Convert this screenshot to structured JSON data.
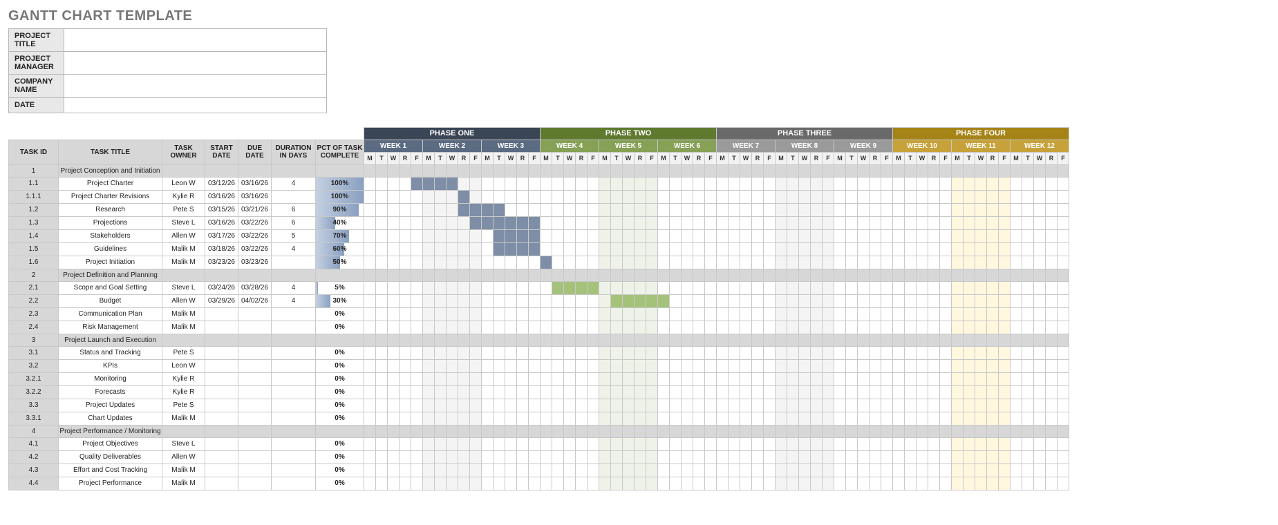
{
  "title": "GANTT CHART TEMPLATE",
  "info": {
    "labels": {
      "project_title": "PROJECT TITLE",
      "project_manager": "PROJECT MANAGER",
      "company_name": "COMPANY NAME",
      "date": "DATE"
    },
    "values": {
      "project_title": "",
      "project_manager": "",
      "company_name": "",
      "date": ""
    }
  },
  "left_headers": {
    "task_id": "TASK ID",
    "task_title": "TASK TITLE",
    "task_owner": "TASK OWNER",
    "start_date": "START DATE",
    "due_date": "DUE DATE",
    "duration": "DURATION IN DAYS",
    "pct": "PCT OF TASK COMPLETE"
  },
  "phases": [
    {
      "label": "PHASE ONE",
      "cls": "phase1",
      "weeks": [
        "WEEK 1",
        "WEEK 2",
        "WEEK 3"
      ]
    },
    {
      "label": "PHASE TWO",
      "cls": "phase2",
      "weeks": [
        "WEEK 4",
        "WEEK 5",
        "WEEK 6"
      ]
    },
    {
      "label": "PHASE THREE",
      "cls": "phase3",
      "weeks": [
        "WEEK 7",
        "WEEK 8",
        "WEEK 9"
      ]
    },
    {
      "label": "PHASE FOUR",
      "cls": "phase4",
      "weeks": [
        "WEEK 10",
        "WEEK 11",
        "WEEK 12"
      ]
    }
  ],
  "day_labels": [
    "M",
    "T",
    "W",
    "R",
    "F"
  ],
  "shaded_weeks": [
    1,
    4,
    7,
    10
  ],
  "tint_weeks": {
    "4": "tint1",
    "10": "tint2"
  },
  "tasks": [
    {
      "id": "1",
      "title": "Project Conception and Initiation",
      "section": true
    },
    {
      "id": "1.1",
      "title": "Project Charter",
      "owner": "Leon W",
      "start": "03/12/26",
      "due": "03/16/26",
      "dur": "4",
      "pct": 100,
      "bar": {
        "color": "blue",
        "start": 4,
        "end": 7
      },
      "indent": 1
    },
    {
      "id": "1.1.1",
      "title": "Project Charter Revisions",
      "owner": "Kylie R",
      "start": "03/16/26",
      "due": "03/16/26",
      "dur": "",
      "pct": 100,
      "bar": {
        "color": "blue",
        "start": 8,
        "end": 8
      },
      "indent": 2
    },
    {
      "id": "1.2",
      "title": "Research",
      "owner": "Pete S",
      "start": "03/15/26",
      "due": "03/21/26",
      "dur": "6",
      "pct": 90,
      "bar": {
        "color": "blue",
        "start": 8,
        "end": 11
      },
      "indent": 1
    },
    {
      "id": "1.3",
      "title": "Projections",
      "owner": "Steve L",
      "start": "03/16/26",
      "due": "03/22/26",
      "dur": "6",
      "pct": 40,
      "bar": {
        "color": "blue",
        "start": 9,
        "end": 14
      },
      "indent": 1
    },
    {
      "id": "1.4",
      "title": "Stakeholders",
      "owner": "Allen W",
      "start": "03/17/26",
      "due": "03/22/26",
      "dur": "5",
      "pct": 70,
      "bar": {
        "color": "blue",
        "start": 11,
        "end": 14
      },
      "indent": 1
    },
    {
      "id": "1.5",
      "title": "Guidelines",
      "owner": "Malik M",
      "start": "03/18/26",
      "due": "03/22/26",
      "dur": "4",
      "pct": 60,
      "bar": {
        "color": "blue",
        "start": 11,
        "end": 14
      },
      "indent": 1
    },
    {
      "id": "1.6",
      "title": "Project Initiation",
      "owner": "Malik M",
      "start": "03/23/26",
      "due": "03/23/26",
      "dur": "",
      "pct": 50,
      "bar": {
        "color": "blue",
        "start": 15,
        "end": 15
      },
      "indent": 1
    },
    {
      "id": "2",
      "title": "Project Definition and Planning",
      "section": true
    },
    {
      "id": "2.1",
      "title": "Scope and Goal Setting",
      "owner": "Steve L",
      "start": "03/24/26",
      "due": "03/28/26",
      "dur": "4",
      "pct": 5,
      "bar": {
        "color": "green",
        "start": 16,
        "end": 19
      },
      "indent": 1
    },
    {
      "id": "2.2",
      "title": "Budget",
      "owner": "Allen W",
      "start": "03/29/26",
      "due": "04/02/26",
      "dur": "4",
      "pct": 30,
      "bar": {
        "color": "green",
        "start": 21,
        "end": 25
      },
      "indent": 1
    },
    {
      "id": "2.3",
      "title": "Communication Plan",
      "owner": "Malik M",
      "start": "",
      "due": "",
      "dur": "",
      "pct": 0,
      "indent": 1
    },
    {
      "id": "2.4",
      "title": "Risk Management",
      "owner": "Malik M",
      "start": "",
      "due": "",
      "dur": "",
      "pct": 0,
      "indent": 1
    },
    {
      "id": "3",
      "title": "Project Launch and Execution",
      "section": true
    },
    {
      "id": "3.1",
      "title": "Status and Tracking",
      "owner": "Pete S",
      "start": "",
      "due": "",
      "dur": "",
      "pct": 0,
      "indent": 1
    },
    {
      "id": "3.2",
      "title": "KPIs",
      "owner": "Leon W",
      "start": "",
      "due": "",
      "dur": "",
      "pct": 0,
      "indent": 1
    },
    {
      "id": "3.2.1",
      "title": "Monitoring",
      "owner": "Kylie R",
      "start": "",
      "due": "",
      "dur": "",
      "pct": 0,
      "indent": 2
    },
    {
      "id": "3.2.2",
      "title": "Forecasts",
      "owner": "Kylie R",
      "start": "",
      "due": "",
      "dur": "",
      "pct": 0,
      "indent": 2
    },
    {
      "id": "3.3",
      "title": "Project Updates",
      "owner": "Pete S",
      "start": "",
      "due": "",
      "dur": "",
      "pct": 0,
      "indent": 1
    },
    {
      "id": "3.3.1",
      "title": "Chart Updates",
      "owner": "Malik M",
      "start": "",
      "due": "",
      "dur": "",
      "pct": 0,
      "indent": 2
    },
    {
      "id": "4",
      "title": "Project Performance / Monitoring",
      "section": true
    },
    {
      "id": "4.1",
      "title": "Project Objectives",
      "owner": "Steve L",
      "start": "",
      "due": "",
      "dur": "",
      "pct": 0,
      "indent": 1
    },
    {
      "id": "4.2",
      "title": "Quality Deliverables",
      "owner": "Allen W",
      "start": "",
      "due": "",
      "dur": "",
      "pct": 0,
      "indent": 1
    },
    {
      "id": "4.3",
      "title": "Effort and Cost Tracking",
      "owner": "Malik M",
      "start": "",
      "due": "",
      "dur": "",
      "pct": 0,
      "indent": 1
    },
    {
      "id": "4.4",
      "title": "Project Performance",
      "owner": "Malik M",
      "start": "",
      "due": "",
      "dur": "",
      "pct": 0,
      "indent": 1
    }
  ],
  "chart_data": {
    "type": "gantt",
    "title": "GANTT CHART TEMPLATE",
    "time_axis": {
      "unit": "weekday",
      "weeks": 12,
      "days_per_week": 5,
      "day_labels": [
        "M",
        "T",
        "W",
        "R",
        "F"
      ],
      "phases": [
        {
          "name": "PHASE ONE",
          "weeks": [
            1,
            2,
            3
          ]
        },
        {
          "name": "PHASE TWO",
          "weeks": [
            4,
            5,
            6
          ]
        },
        {
          "name": "PHASE THREE",
          "weeks": [
            7,
            8,
            9
          ]
        },
        {
          "name": "PHASE FOUR",
          "weeks": [
            10,
            11,
            12
          ]
        }
      ]
    },
    "series": [
      {
        "id": "1.1",
        "name": "Project Charter",
        "start_day": 4,
        "end_day": 7,
        "pct_complete": 100,
        "color": "#7d8ea6"
      },
      {
        "id": "1.1.1",
        "name": "Project Charter Revisions",
        "start_day": 8,
        "end_day": 8,
        "pct_complete": 100,
        "color": "#7d8ea6"
      },
      {
        "id": "1.2",
        "name": "Research",
        "start_day": 8,
        "end_day": 11,
        "pct_complete": 90,
        "color": "#7d8ea6"
      },
      {
        "id": "1.3",
        "name": "Projections",
        "start_day": 9,
        "end_day": 14,
        "pct_complete": 40,
        "color": "#7d8ea6"
      },
      {
        "id": "1.4",
        "name": "Stakeholders",
        "start_day": 11,
        "end_day": 14,
        "pct_complete": 70,
        "color": "#7d8ea6"
      },
      {
        "id": "1.5",
        "name": "Guidelines",
        "start_day": 11,
        "end_day": 14,
        "pct_complete": 60,
        "color": "#7d8ea6"
      },
      {
        "id": "1.6",
        "name": "Project Initiation",
        "start_day": 15,
        "end_day": 15,
        "pct_complete": 50,
        "color": "#7d8ea6"
      },
      {
        "id": "2.1",
        "name": "Scope and Goal Setting",
        "start_day": 16,
        "end_day": 19,
        "pct_complete": 5,
        "color": "#a5c27a"
      },
      {
        "id": "2.2",
        "name": "Budget",
        "start_day": 21,
        "end_day": 25,
        "pct_complete": 30,
        "color": "#a5c27a"
      }
    ]
  }
}
